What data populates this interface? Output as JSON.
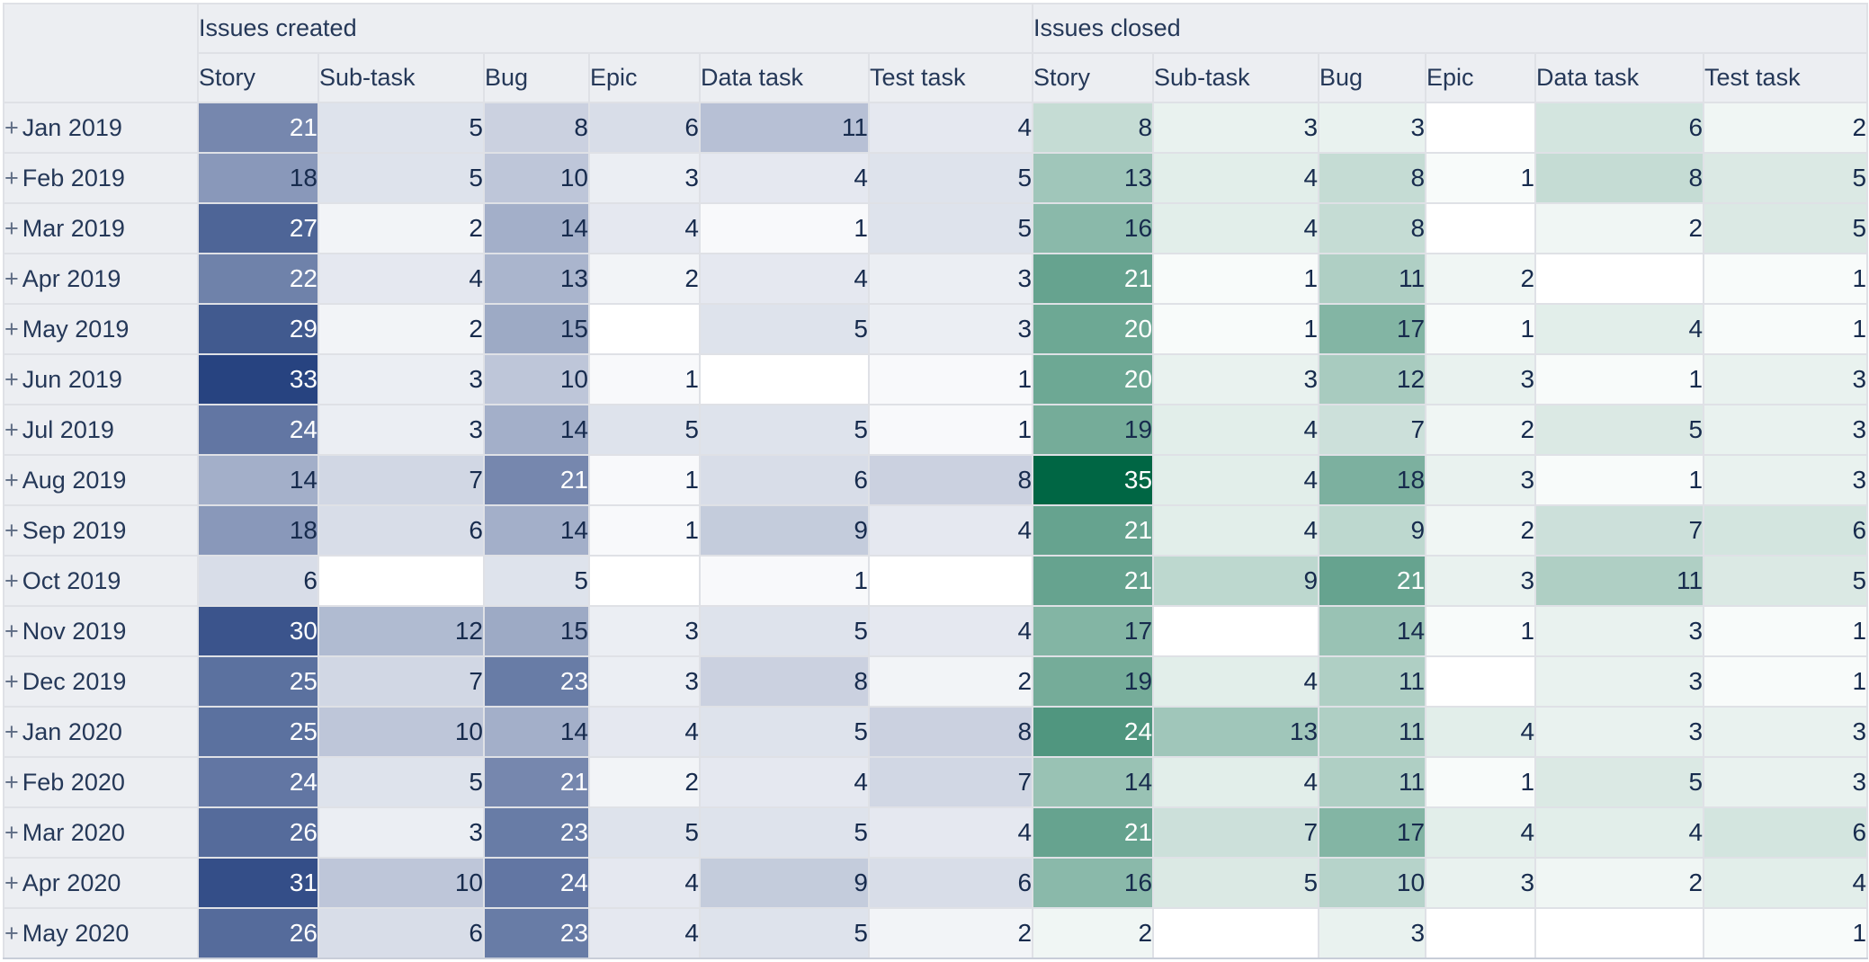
{
  "table": {
    "groups": [
      {
        "label": "Issues created",
        "color": "#274380",
        "key": "created"
      },
      {
        "label": "Issues closed",
        "color": "#006644",
        "key": "closed"
      }
    ],
    "columns": [
      "Story",
      "Sub-task",
      "Bug",
      "Epic",
      "Data task",
      "Test task"
    ],
    "expand_glyph": "+",
    "rows": [
      {
        "label": "Jan 2019",
        "created": [
          21,
          5,
          8,
          6,
          11,
          4
        ],
        "closed": [
          8,
          3,
          3,
          null,
          6,
          2
        ]
      },
      {
        "label": "Feb 2019",
        "created": [
          18,
          5,
          10,
          3,
          4,
          5
        ],
        "closed": [
          13,
          4,
          8,
          1,
          8,
          5
        ]
      },
      {
        "label": "Mar 2019",
        "created": [
          27,
          2,
          14,
          4,
          1,
          5
        ],
        "closed": [
          16,
          4,
          8,
          null,
          2,
          5
        ]
      },
      {
        "label": "Apr 2019",
        "created": [
          22,
          4,
          13,
          2,
          4,
          3
        ],
        "closed": [
          21,
          1,
          11,
          2,
          null,
          1
        ]
      },
      {
        "label": "May 2019",
        "created": [
          29,
          2,
          15,
          null,
          5,
          3
        ],
        "closed": [
          20,
          1,
          17,
          1,
          4,
          1
        ]
      },
      {
        "label": "Jun 2019",
        "created": [
          33,
          3,
          10,
          1,
          null,
          1
        ],
        "closed": [
          20,
          3,
          12,
          3,
          1,
          3
        ]
      },
      {
        "label": "Jul 2019",
        "created": [
          24,
          3,
          14,
          5,
          5,
          1
        ],
        "closed": [
          19,
          4,
          7,
          2,
          5,
          3
        ]
      },
      {
        "label": "Aug 2019",
        "created": [
          14,
          7,
          21,
          1,
          6,
          8
        ],
        "closed": [
          35,
          4,
          18,
          3,
          1,
          3
        ]
      },
      {
        "label": "Sep 2019",
        "created": [
          18,
          6,
          14,
          1,
          9,
          4
        ],
        "closed": [
          21,
          4,
          9,
          2,
          7,
          6
        ]
      },
      {
        "label": "Oct 2019",
        "created": [
          6,
          null,
          5,
          null,
          1,
          null
        ],
        "closed": [
          21,
          9,
          21,
          3,
          11,
          5
        ]
      },
      {
        "label": "Nov 2019",
        "created": [
          30,
          12,
          15,
          3,
          5,
          4
        ],
        "closed": [
          17,
          null,
          14,
          1,
          3,
          1
        ]
      },
      {
        "label": "Dec 2019",
        "created": [
          25,
          7,
          23,
          3,
          8,
          2
        ],
        "closed": [
          19,
          4,
          11,
          null,
          3,
          1
        ]
      },
      {
        "label": "Jan 2020",
        "created": [
          25,
          10,
          14,
          4,
          5,
          8
        ],
        "closed": [
          24,
          13,
          11,
          4,
          3,
          3
        ]
      },
      {
        "label": "Feb 2020",
        "created": [
          24,
          5,
          21,
          2,
          4,
          7
        ],
        "closed": [
          14,
          4,
          11,
          1,
          5,
          3
        ]
      },
      {
        "label": "Mar 2020",
        "created": [
          26,
          3,
          23,
          5,
          5,
          4
        ],
        "closed": [
          21,
          7,
          17,
          4,
          4,
          6
        ]
      },
      {
        "label": "Apr 2020",
        "created": [
          31,
          10,
          24,
          4,
          9,
          6
        ],
        "closed": [
          16,
          5,
          10,
          3,
          2,
          4
        ]
      },
      {
        "label": "May 2020",
        "created": [
          26,
          6,
          23,
          4,
          5,
          2
        ],
        "closed": [
          2,
          null,
          3,
          null,
          null,
          1
        ]
      }
    ]
  }
}
